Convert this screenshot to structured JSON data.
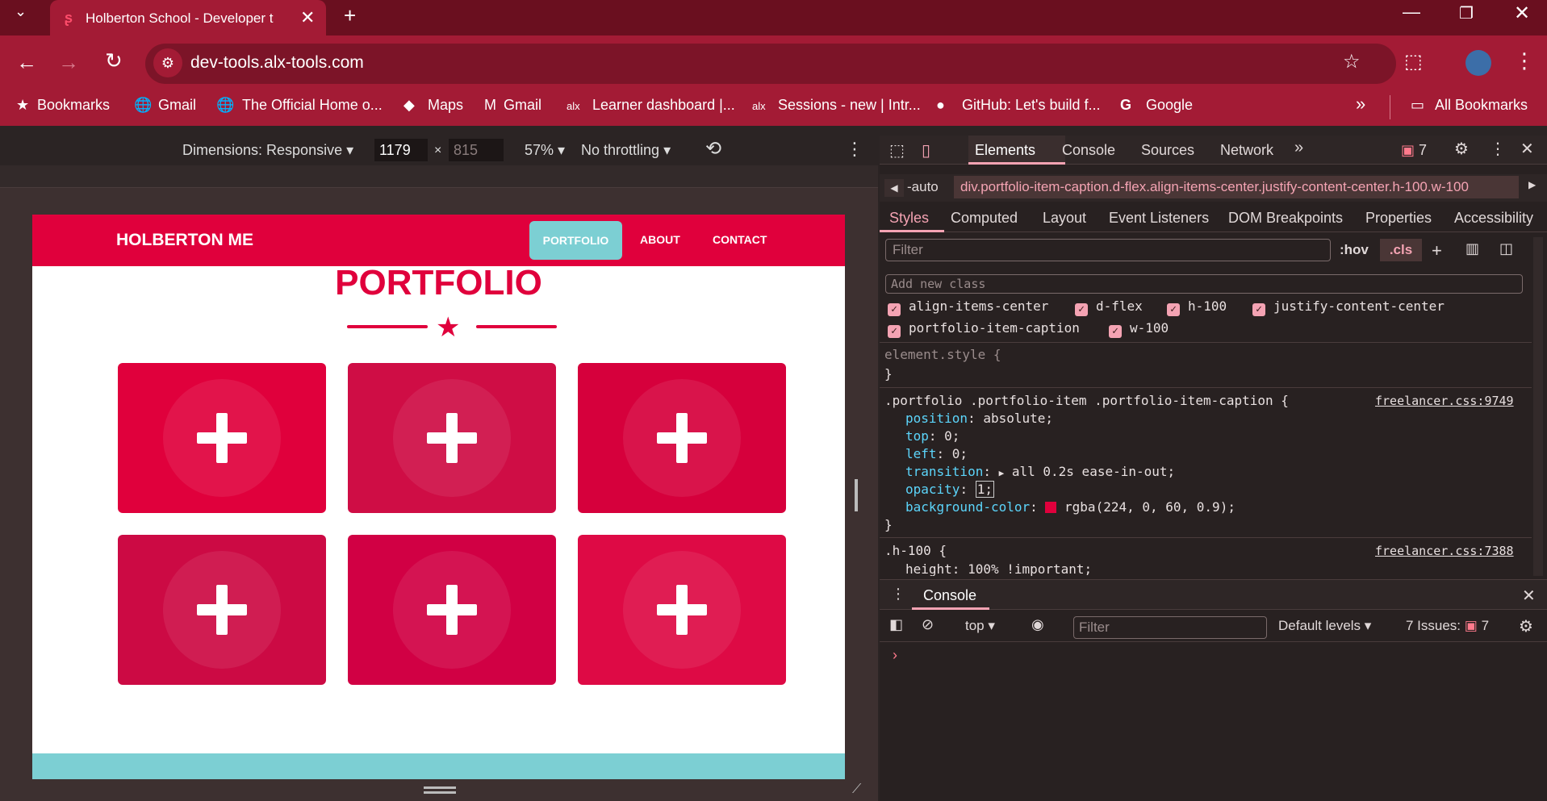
{
  "browser": {
    "tab_title": "Holberton School - Developer t",
    "url": "dev-tools.alx-tools.com",
    "bookmarks": [
      "Bookmarks",
      "Gmail",
      "The Official Home o...",
      "Maps",
      "Gmail",
      "Learner dashboard |...",
      "Sessions - new | Intr...",
      "GitHub: Let's build f...",
      "Google"
    ],
    "all_bookmarks": "All Bookmarks"
  },
  "device_toolbar": {
    "dimensions": "Dimensions: Responsive",
    "width": "1179",
    "height": "815",
    "zoom": "57%",
    "throttling": "No throttling"
  },
  "page": {
    "brand": "HOLBERTON ME",
    "nav": [
      "PORTFOLIO",
      "ABOUT",
      "CONTACT"
    ],
    "title": "PORTFOLIO",
    "cards": [
      {
        "color": "#e0003c"
      },
      {
        "color": "#cf0d45"
      },
      {
        "color": "#d6003c"
      },
      {
        "color": "#cc0a44"
      },
      {
        "color": "#d10044"
      },
      {
        "color": "#de0a45"
      }
    ],
    "accent": "#e0003c",
    "teal": "#7ccfd3"
  },
  "devtools": {
    "tabs": [
      "Elements",
      "Console",
      "Sources",
      "Network"
    ],
    "issues_count": "7",
    "breadcrumb_prefix": "-auto",
    "breadcrumb": "div.portfolio-item-caption.d-flex.align-items-center.justify-content-center.h-100.w-100",
    "subtabs": [
      "Styles",
      "Computed",
      "Layout",
      "Event Listeners",
      "DOM Breakpoints",
      "Properties",
      "Accessibility"
    ],
    "filter_placeholder": "Filter",
    "hov": ":hov",
    "cls": ".cls",
    "new_class_placeholder": "Add new class",
    "classes": [
      "align-items-center",
      "d-flex",
      "h-100",
      "justify-content-center",
      "portfolio-item-caption",
      "w-100"
    ],
    "element_style": "element.style {",
    "close_brace": "}",
    "rule1_selector": ".portfolio .portfolio-item .portfolio-item-caption {",
    "rule1_source": "freelancer.css:9749",
    "rule1_props": [
      {
        "name": "position",
        "value": "absolute;"
      },
      {
        "name": "top",
        "value": "0;"
      },
      {
        "name": "left",
        "value": "0;"
      },
      {
        "name": "transition",
        "value": "all 0.2s ease-in-out;"
      },
      {
        "name": "opacity",
        "value": "1;"
      },
      {
        "name": "background-color",
        "value": "rgba(224, 0, 60, 0.9);"
      }
    ],
    "rule2_selector": ".h-100 {",
    "rule2_source": "freelancer.css:7388",
    "rule2_prop": "height: 100% !important;",
    "console_title": "Console",
    "console_context": "top",
    "console_filter": "Filter",
    "default_levels": "Default levels",
    "issues_label": "7 Issues:",
    "console_issues": "7"
  }
}
